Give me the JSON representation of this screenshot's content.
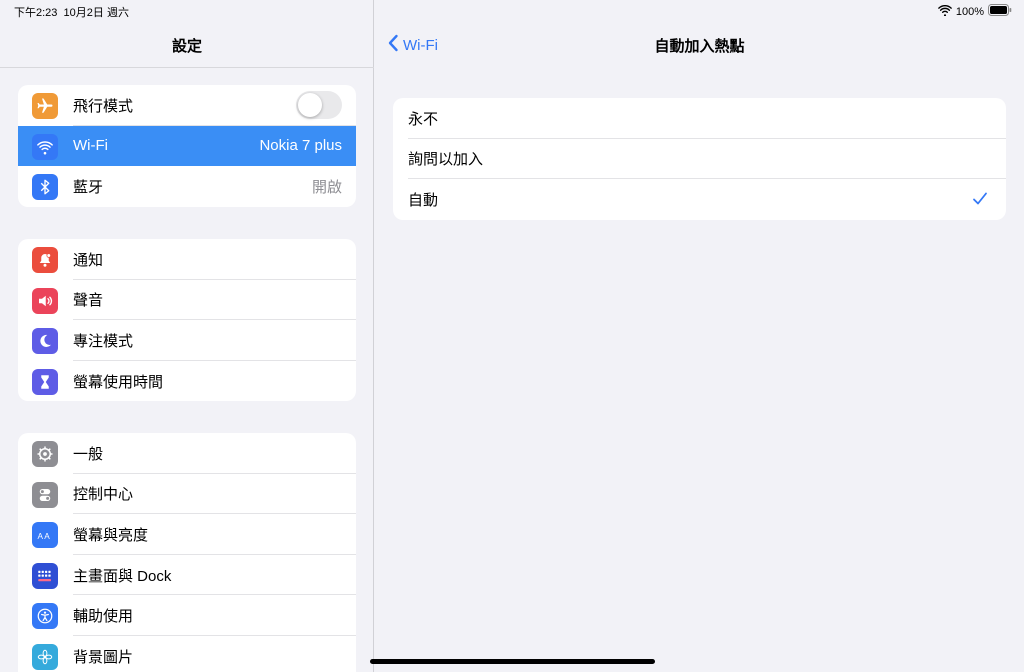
{
  "status": {
    "time": "下午2:23",
    "date": "10月2日 週六",
    "battery": "100%"
  },
  "sidebar": {
    "title": "設定",
    "groups": [
      [
        {
          "label": "飛行模式",
          "icon": "airplane-icon",
          "color": "#f09a37"
        },
        {
          "label": "Wi-Fi",
          "value": "Nokia 7 plus",
          "icon": "wifi-icon",
          "color": "#3478f6"
        },
        {
          "label": "藍牙",
          "value": "開啟",
          "icon": "bluetooth-icon",
          "color": "#3478f6"
        }
      ],
      [
        {
          "label": "通知",
          "icon": "bell-icon",
          "color": "#eb4d3d"
        },
        {
          "label": "聲音",
          "icon": "speaker-icon",
          "color": "#eb445a"
        },
        {
          "label": "專注模式",
          "icon": "moon-icon",
          "color": "#5e5ce6"
        },
        {
          "label": "螢幕使用時間",
          "icon": "hourglass-icon",
          "color": "#5e5ce6"
        }
      ],
      [
        {
          "label": "一般",
          "icon": "gear-icon",
          "color": "#8e8e93"
        },
        {
          "label": "控制中心",
          "icon": "switches-icon",
          "color": "#8e8e93"
        },
        {
          "label": "螢幕與亮度",
          "icon": "text-size-icon",
          "color": "#3478f6"
        },
        {
          "label": "主畫面與 Dock",
          "icon": "home-grid-icon",
          "color": "#3478f6"
        },
        {
          "label": "輔助使用",
          "icon": "accessibility-icon",
          "color": "#3478f6"
        },
        {
          "label": "背景圖片",
          "icon": "flower-icon",
          "color": "#35aadc"
        }
      ]
    ]
  },
  "detail": {
    "back_label": "Wi-Fi",
    "title": "自動加入熱點",
    "options": [
      {
        "label": "永不",
        "checked": false
      },
      {
        "label": "詢問以加入",
        "checked": false
      },
      {
        "label": "自動",
        "checked": true
      }
    ]
  },
  "colors": {
    "accent": "#3478f6",
    "selected_row": "#3a8ef5"
  }
}
